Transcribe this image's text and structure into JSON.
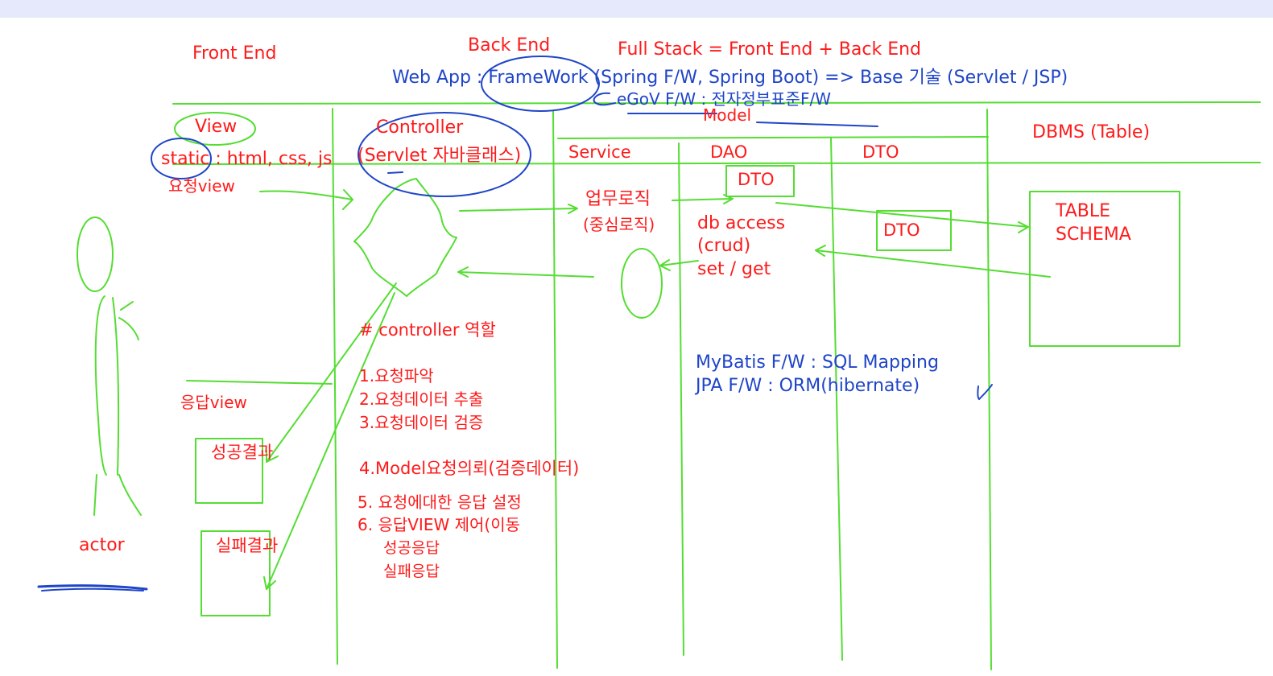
{
  "colors": {
    "red": "#ff1a1a",
    "blue": "#1f45c8",
    "green": "#55dd33",
    "topbar": "#e6e8fb"
  },
  "labels": {
    "front_end": "Front End",
    "back_end": "Back End",
    "full_stack": "Full Stack = Front End + Back End",
    "web_app": "Web App : FrameWork (Spring F/W, Spring Boot) => Base 기술 (Servlet / JSP)",
    "egov": "eGoV F/W : 전자정부표준F/W",
    "model": "Model",
    "dbms": "DBMS (Table)",
    "view": "View",
    "controller": "Controller",
    "static_line": "static : html, css, js",
    "servlet": "(Servlet 자바클래스)",
    "request_view": "요청view",
    "service": "Service",
    "dao": "DAO",
    "dto_header": "DTO",
    "dto_box1": "DTO",
    "dto_box2": "DTO",
    "business_logic": "업무로직",
    "core_logic": "(중심로직)",
    "db_access": "db access",
    "crud": "(crud)",
    "set_get": "set / get",
    "table": "TABLE",
    "schema": "SCHEMA",
    "controller_role": "# controller 역할",
    "role_items": [
      "1.요청파악",
      "2.요청데이터 추출",
      "3.요청데이터 검증",
      "4.Model요청의뢰(검증데이터)",
      "5. 요청에대한 응답 설정",
      "6. 응답VIEW 제어(이동",
      "성공응답",
      "실패응답"
    ],
    "response_view": "응답view",
    "success_result": "성공결과",
    "failure_result": "실패결과",
    "actor": "actor",
    "mybatis": "MyBatis F/W : SQL Mapping",
    "jpa": "JPA F/W : ORM(hibernate)"
  }
}
